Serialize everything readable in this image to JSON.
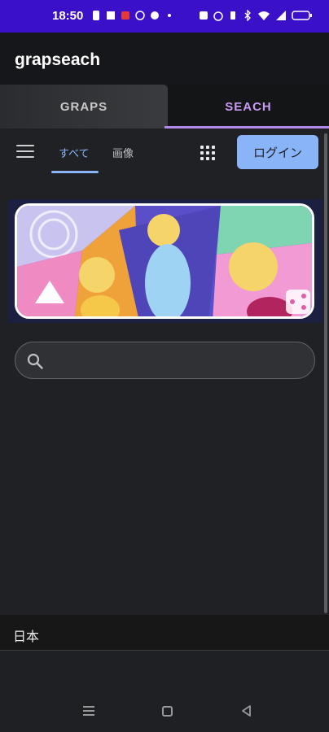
{
  "status_bar": {
    "time": "18:50"
  },
  "app_bar": {
    "title": "grapseach"
  },
  "tabs": [
    {
      "label": "GRAPS",
      "selected": false
    },
    {
      "label": "SEACH",
      "selected": true
    }
  ],
  "search_page": {
    "nav_all": "すべて",
    "nav_images": "画像",
    "login_label": "ログイン",
    "accent_color": "#8ab4f8"
  },
  "footer": {
    "country": "日本"
  },
  "icons": [
    "menu-icon",
    "apps-grid-icon",
    "search-icon",
    "share-icon",
    "recent-apps-icon",
    "home-icon",
    "back-icon"
  ]
}
